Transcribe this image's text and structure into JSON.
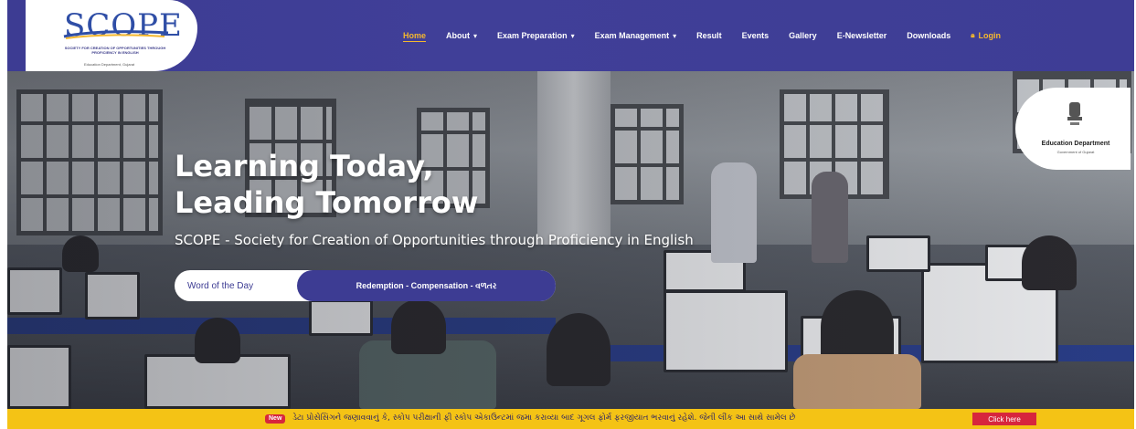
{
  "brand": {
    "logo_text": "SCOPE",
    "logo_subtitle": "SOCIETY FOR CREATION OF OPPORTUNITIES THROUGH PROFICIENCY IN ENGLISH",
    "logo_footer": "Education Department, Gujarat"
  },
  "nav": {
    "items": [
      {
        "label": "Home",
        "active": true
      },
      {
        "label": "About",
        "dropdown": true
      },
      {
        "label": "Exam Preparation",
        "dropdown": true
      },
      {
        "label": "Exam Management",
        "dropdown": true
      },
      {
        "label": "Result"
      },
      {
        "label": "Events"
      },
      {
        "label": "Gallery"
      },
      {
        "label": "E-Newsletter"
      },
      {
        "label": "Downloads"
      }
    ],
    "login_label": "Login",
    "login_icon": "lock-icon"
  },
  "hero": {
    "title_line1": "Learning Today,",
    "title_line2": "Leading Tomorrow",
    "subtitle": "SCOPE - Society for Creation of Opportunities through Proficiency in English",
    "word_of_day_label": "Word of the Day",
    "word_of_day_value": "Redemption - Compensation - વળતર"
  },
  "badge": {
    "emblem_icon": "national-emblem-icon",
    "name": "Education Department",
    "sub": "Government of Gujarat"
  },
  "ticker": {
    "new_label": "New",
    "message": "ડેટા પ્રોસેસિંગને જણાવવાનું કે, સ્કોપ પરીક્ષાની ફી સ્કોપ એકાઉન્ટમાં જમા કરાવ્યા બાદ ગૂગલ ફોર્મ ફરજીયાત ભરવાનું રહેશે. જેની લીંક આ સાથે સામેલ છે",
    "cta_label": "Click here"
  },
  "colors": {
    "header_bg": "#3d3c93",
    "accent_gold": "#f5b82e",
    "ticker_bg": "#f4c315",
    "cta_red": "#d7263d"
  }
}
